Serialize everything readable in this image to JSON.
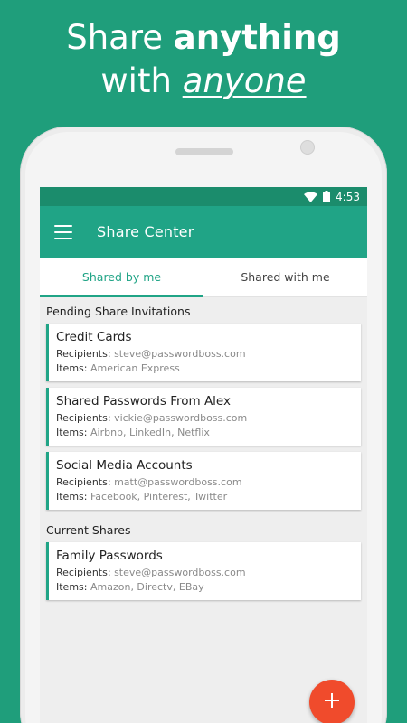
{
  "headline": {
    "line1_regular": "Share ",
    "line1_bold": "anything",
    "line2_regular": "with ",
    "line2_emphasis": "anyone"
  },
  "status_bar": {
    "time": "4:53",
    "icons": [
      "wifi-icon",
      "battery-icon"
    ]
  },
  "app_bar": {
    "title": "Share Center",
    "menu_icon": "hamburger-menu-icon"
  },
  "tabs": [
    {
      "label": "Shared by me",
      "active": true
    },
    {
      "label": "Shared with me",
      "active": false
    }
  ],
  "labels": {
    "recipients": "Recipients:",
    "items": "Items:"
  },
  "sections": [
    {
      "title": "Pending Share Invitations",
      "cards": [
        {
          "title": "Credit Cards",
          "recipients": "steve@passwordboss.com",
          "items": "American Express"
        },
        {
          "title": "Shared Passwords From Alex",
          "recipients": "vickie@passwordboss.com",
          "items": "Airbnb, LinkedIn, Netflix"
        },
        {
          "title": "Social Media Accounts",
          "recipients": "matt@passwordboss.com",
          "items": "Facebook, Pinterest, Twitter"
        }
      ]
    },
    {
      "title": "Current Shares",
      "cards": [
        {
          "title": "Family Passwords",
          "recipients": "steve@passwordboss.com",
          "items": "Amazon, Directv, EBay"
        }
      ]
    }
  ],
  "fab": {
    "icon": "plus-icon"
  },
  "colors": {
    "background": "#1f9e7b",
    "status_bar": "#1b8c6c",
    "app_bar": "#20a486",
    "accent": "#20a486",
    "fab": "#f04b2c"
  }
}
